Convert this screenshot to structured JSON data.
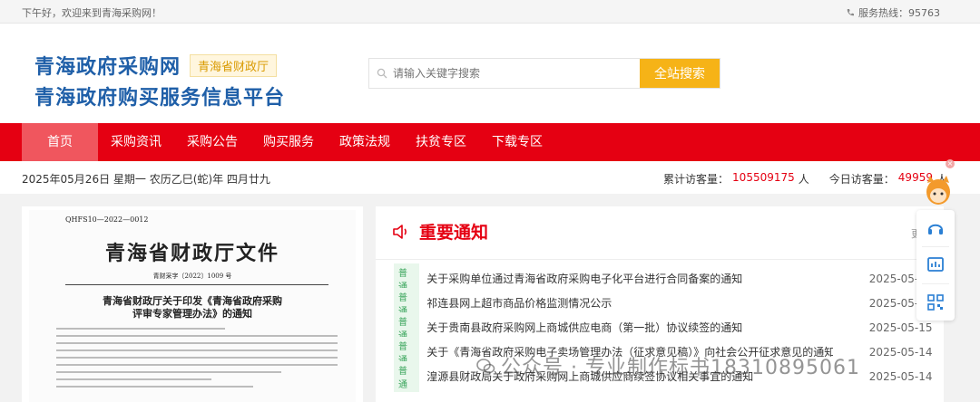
{
  "topbar": {
    "greeting": "下午好，欢迎来到青海采购网！",
    "hotline": "服务热线：95763"
  },
  "header": {
    "logo_line1": "青海政府采购网",
    "logo_badge": "青海省财政厅",
    "logo_line2": "青海政府购买服务信息平台"
  },
  "search": {
    "placeholder": "请输入关键字搜索",
    "button_label": "全站搜索"
  },
  "nav": {
    "items": [
      {
        "label": "首页",
        "active": true
      },
      {
        "label": "采购资讯"
      },
      {
        "label": "采购公告"
      },
      {
        "label": "购买服务"
      },
      {
        "label": "政策法规"
      },
      {
        "label": "扶贫专区"
      },
      {
        "label": "下载专区"
      }
    ]
  },
  "datebar": {
    "date_text": "2025年05月26日 星期一 农历乙巳(蛇)年 四月廿九",
    "total_label": "累计访客量：",
    "total_value": "105509175",
    "total_unit": "人",
    "today_label": "今日访客量：",
    "today_value": "49959",
    "today_unit": "人"
  },
  "document": {
    "code": "QHFS10—2022—0012",
    "title": "青海省财政厅文件",
    "file_no": "青财采字〔2022〕1009 号",
    "heading1": "青海省财政厅关于印发《青海省政府采购",
    "heading2": "评审专家管理办法》的通知"
  },
  "notice": {
    "title": "重要通知",
    "more_label": "更多",
    "items": [
      {
        "tag": "普通",
        "title": "关于采购单位通过青海省政府采购电子化平台进行合同备案的通知",
        "date": "2025-05-"
      },
      {
        "tag": "普通",
        "title": "祁连县网上超市商品价格监测情况公示",
        "date": "2025-05-"
      },
      {
        "tag": "普通",
        "title": "关于贵南县政府采购网上商城供应电商（第一批）协议续签的通知",
        "date": "2025-05-15"
      },
      {
        "tag": "普通",
        "title": "关于《青海省政府采购电子卖场管理办法（征求意见稿）》向社会公开征求意见的通知",
        "date": "2025-05-14"
      },
      {
        "tag": "普通",
        "title": "湟源县财政局关于政府采购网上商城供应商续签协议相关事宜的通知",
        "date": "2025-05-14"
      }
    ]
  },
  "watermark": {
    "text": "公众号 · 专业制作标书18310895061"
  },
  "colors": {
    "brand_red": "#e50012",
    "nav_active": "#f0565e",
    "logo_blue": "#1f5fa8",
    "search_button": "#f6b317",
    "tag_green": "#3aa55c"
  }
}
